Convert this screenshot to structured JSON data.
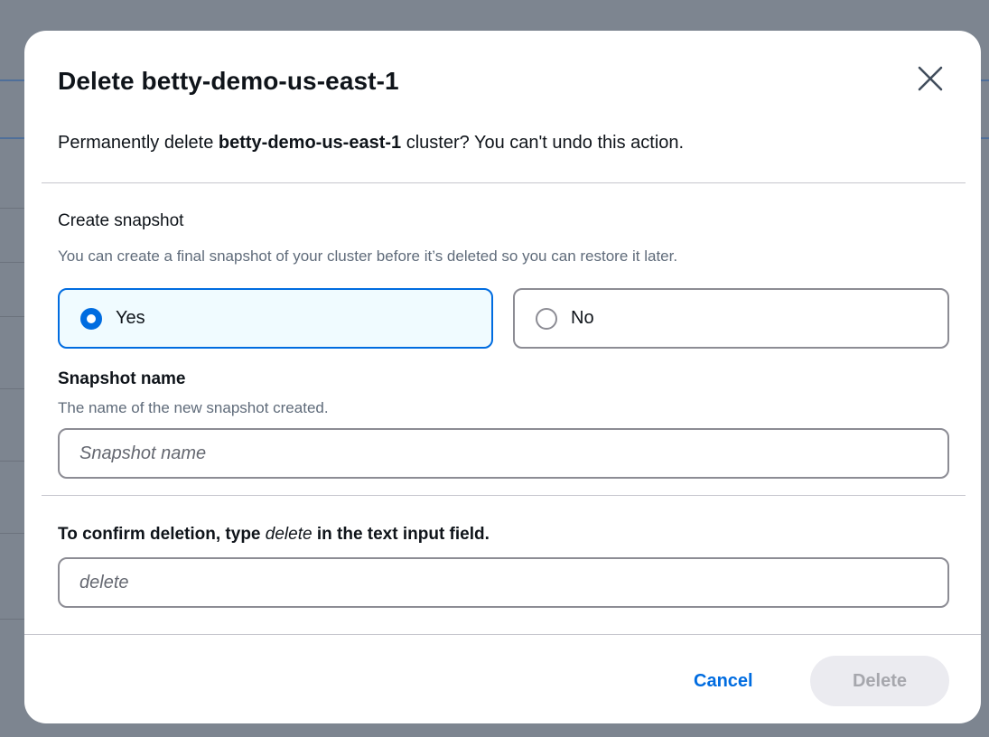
{
  "modal": {
    "title": "Delete betty-demo-us-east-1",
    "intro_prefix": "Permanently delete ",
    "intro_cluster": "betty-demo-us-east-1",
    "intro_suffix": " cluster? You can't undo this action."
  },
  "snapshot": {
    "label": "Create snapshot",
    "description": "You can create a final snapshot of your cluster before it’s deleted so you can restore it later.",
    "options": [
      {
        "label": "Yes",
        "selected": true
      },
      {
        "label": "No",
        "selected": false
      }
    ],
    "name_label": "Snapshot name",
    "name_description": "The name of the new snapshot created.",
    "name_value": "",
    "name_placeholder": "Snapshot name"
  },
  "confirm": {
    "label_prefix": "To confirm deletion, type ",
    "label_keyword": "delete",
    "label_suffix": " in the text input field.",
    "value": "",
    "placeholder": "delete"
  },
  "footer": {
    "cancel_label": "Cancel",
    "delete_label": "Delete"
  },
  "colors": {
    "accent": "#006ce0",
    "selected_tile_bg": "#f0fbff",
    "disabled_button_bg": "#ebebf0",
    "disabled_button_text": "#a6a7ad",
    "backdrop": "#7d8590"
  },
  "icons": {
    "close": "close-icon"
  }
}
